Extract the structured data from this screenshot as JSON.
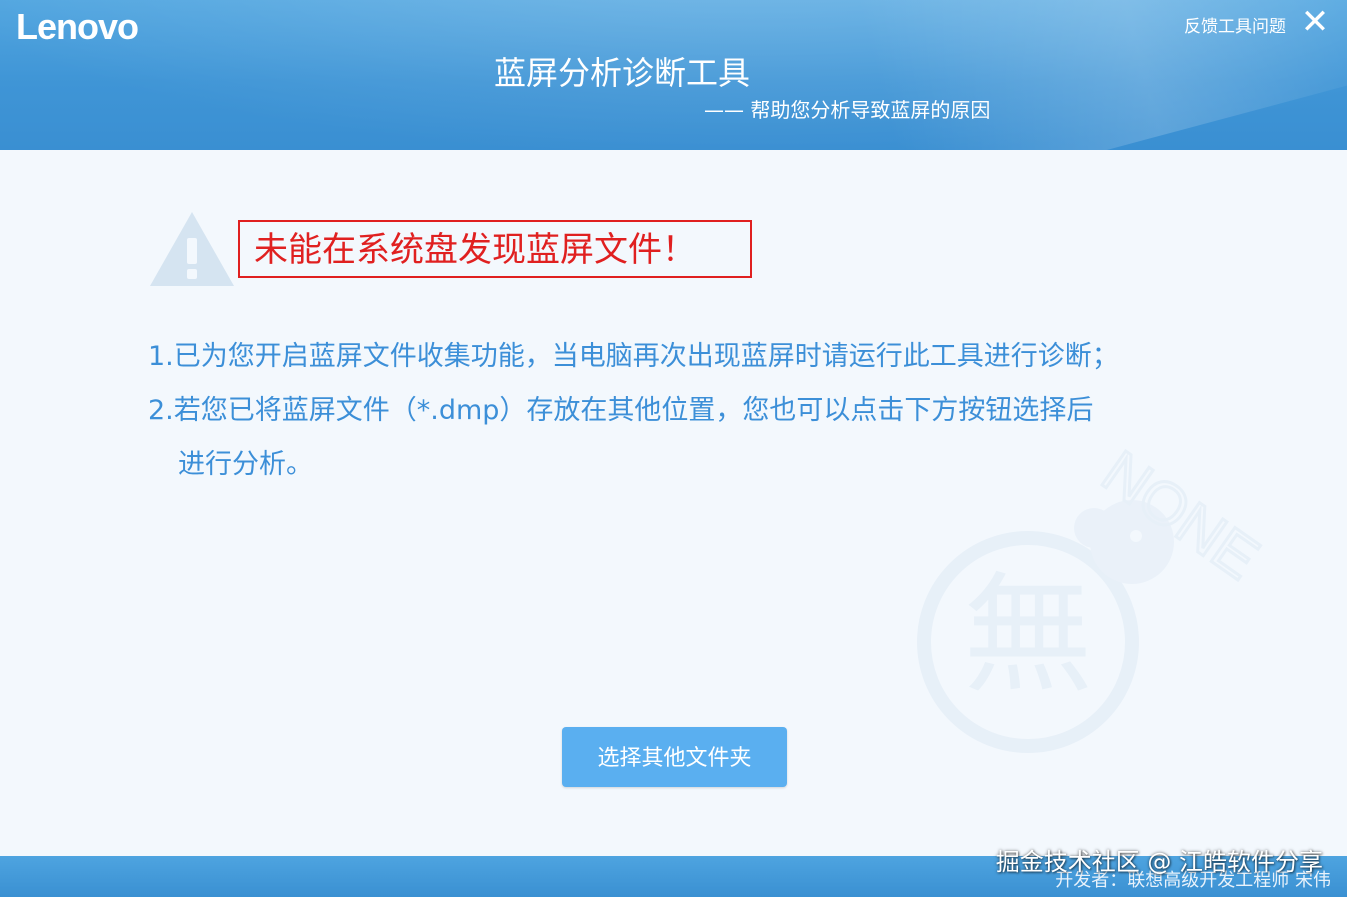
{
  "header": {
    "logo": "Lenovo",
    "title": "蓝屏分析诊断工具",
    "subtitle": "—— 帮助您分析导致蓝屏的原因",
    "feedback_label": "反馈工具问题",
    "close_glyph": "✕"
  },
  "alert": {
    "message": "未能在系统盘发现蓝屏文件！",
    "icon": "warning-triangle-icon",
    "color": "#e02020"
  },
  "instructions": [
    "1.已为您开启蓝屏文件收集功能，当电脑再次出现蓝屏时请运行此工具进行诊断；",
    "2.若您已将蓝屏文件（*.dmp）存放在其他位置，您也可以点击下方按钮选择后",
    "进行分析。"
  ],
  "watermark": {
    "text": "NONE",
    "glyph": "無"
  },
  "button": {
    "label": "选择其他文件夹"
  },
  "footer": {
    "developer": "开发者：联想高级开发工程师 宋伟",
    "credit": "掘金技术社区 @ 江皓软件分享"
  },
  "colors": {
    "header_blue": "#3f95d6",
    "text_blue": "#3c8fd8",
    "button_blue": "#5aaff0"
  }
}
